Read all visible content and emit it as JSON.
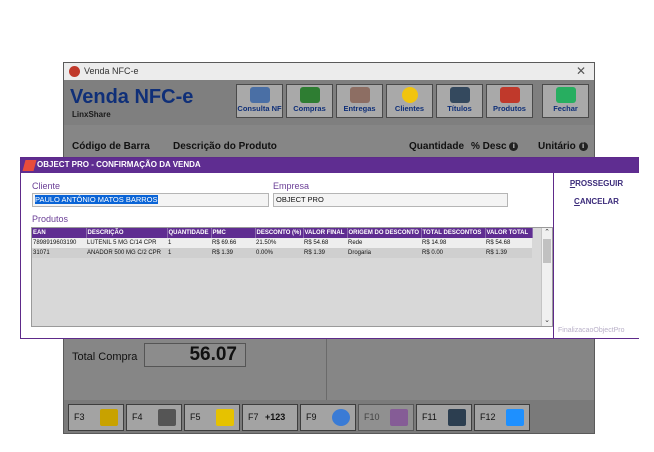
{
  "main_window": {
    "title": "Venda NFC-e",
    "close_glyph": "✕",
    "app_name": "Venda NFC-e",
    "app_subtitle": "LinxShare",
    "toolbar": [
      {
        "label": "Consulta NF",
        "icon": "magnifier-document-icon",
        "color": "#4a6fa5"
      },
      {
        "label": "Compras",
        "icon": "truck-icon",
        "color": "#2e7d32"
      },
      {
        "label": "Entregas",
        "icon": "delivery-box-icon",
        "color": "#8d6e63"
      },
      {
        "label": "Clientes",
        "icon": "smiley-face-icon",
        "color": "#f1c40f"
      },
      {
        "label": "Títulos",
        "icon": "ledger-icon",
        "color": "#34495e"
      },
      {
        "label": "Produtos",
        "icon": "medicine-bottles-icon",
        "color": "#c0392b"
      },
      {
        "label": "Fechar",
        "icon": "exit-arrow-icon",
        "color": "#27ae60"
      }
    ],
    "columns": {
      "codigo": "Código de Barra",
      "descricao": "Descrição do Produto",
      "quantidade": "Quantidade",
      "desconto": "% Desc",
      "unitario": "Unitário"
    },
    "total_label": "Total Compra",
    "total_value": "56.07",
    "fkeys": [
      {
        "key": "F3",
        "icon": "pen-paper-icon",
        "color": "#c8a200"
      },
      {
        "key": "F4",
        "icon": "printer-icon",
        "color": "#555555"
      },
      {
        "key": "F5",
        "icon": "notes-icon",
        "color": "#e6c200"
      },
      {
        "key": "F7",
        "icon": "plus-123-icon",
        "label": "+123",
        "color": ""
      },
      {
        "key": "F9",
        "icon": "globe-icon",
        "color": "#3a7bd5"
      },
      {
        "key": "F10",
        "icon": "gift-icon",
        "color": "#8e44ad",
        "disabled": true
      },
      {
        "key": "F11",
        "icon": "calculator-icon",
        "color": "#2c3e50"
      },
      {
        "key": "F12",
        "icon": "first-aid-kit-icon",
        "color": "#1e90ff"
      }
    ]
  },
  "dialog": {
    "title": "OBJECT PRO - CONFIRMAÇÃO DA VENDA",
    "cliente_label": "Cliente",
    "cliente_value": "PAULO ANTÔNIO MATOS BARROS",
    "empresa_label": "Empresa",
    "empresa_value": "OBJECT PRO",
    "produtos_label": "Produtos",
    "table": {
      "headers": [
        "EAN",
        "DESCRIÇÃO",
        "QUANTIDADE",
        "PMC",
        "DESCONTO (%)",
        "VALOR FINAL",
        "ORIGEM DO DESCONTO",
        "TOTAL DESCONTOS",
        "VALOR TOTAL"
      ],
      "rows": [
        [
          "7898919603190",
          "LUTENIL 5 MG C/14 CPR",
          "1",
          "R$ 69.66",
          "21.50%",
          "R$ 54.68",
          "Rede",
          "R$ 14.98",
          "R$ 54.68"
        ],
        [
          "31071",
          "ANADOR 500 MG C/2 CPR",
          "1",
          "R$ 1.39",
          "0.00%",
          "R$ 1.39",
          "Drogaria",
          "R$ 0.00",
          "R$ 1.39"
        ]
      ]
    },
    "scroll_up": "⌃",
    "scroll_down": "⌄",
    "prosseguir_first": "P",
    "prosseguir_rest": "ROSSEGUIR",
    "cancelar_first": "C",
    "cancelar_rest": "ANCELAR",
    "footer": "FinalizacaoObjectPro"
  }
}
